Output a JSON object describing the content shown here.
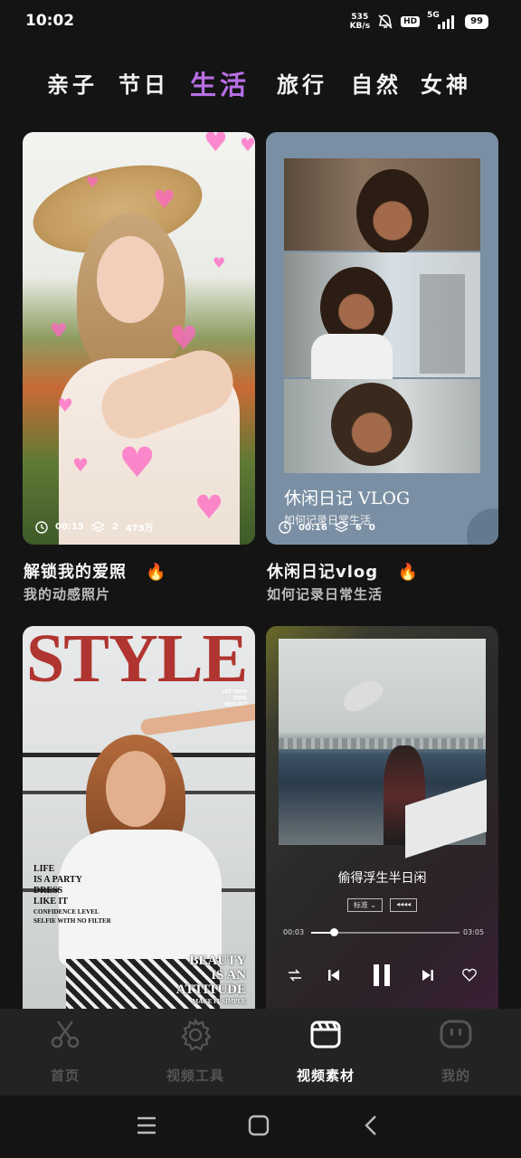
{
  "status_bar": {
    "time": "10:02",
    "net_speed_value": "535",
    "net_speed_unit": "KB/s",
    "hd": "HD",
    "network": "5G",
    "battery": "99"
  },
  "categories": [
    {
      "label": "亲子",
      "active": false
    },
    {
      "label": "节日",
      "active": false
    },
    {
      "label": "生活",
      "active": true
    },
    {
      "label": "旅行",
      "active": false
    },
    {
      "label": "自然",
      "active": false
    },
    {
      "label": "女神",
      "active": false
    }
  ],
  "cards": [
    {
      "title": "解锁我的爱照",
      "subtitle": "我的动感照片",
      "duration": "00:15",
      "layers": "2",
      "views": "473万",
      "hot_icon": "fire-icon"
    },
    {
      "title": "休闲日记vlog",
      "subtitle": "如何记录日常生活",
      "duration": "00:16",
      "layers": "6",
      "views": "0",
      "overlay_title": "休闲日记 VLOG",
      "overlay_subtitle": "如何记录日常生活",
      "hot_icon": "fire-icon"
    },
    {
      "magazine_title": "STYLE",
      "side_text": "LET YOUR SOUL REFLECT WHO YOU TRULY ARE",
      "left_text_1": "LIFE",
      "left_text_2": "IS A PARTY",
      "left_text_3": "DRESS",
      "left_text_4": "LIKE IT",
      "left_text_5": "CONFIDENCE LEVEL",
      "left_text_6": "SELFIE WITH NO FILTER",
      "beauty_1": "BEAUTY",
      "beauty_2": "IS AN",
      "beauty_3": "ATTITUDE",
      "beauty_4": "MAKE IT SIMPLE"
    },
    {
      "song_title": "偷得浮生半日闲",
      "quality": "标准",
      "effect_label": "◂◂◂◂",
      "time_current": "00:03",
      "time_total": "03:05",
      "progress": 0.15
    }
  ],
  "bottom_nav": [
    {
      "label": "首页",
      "icon": "scissors-icon",
      "active": false
    },
    {
      "label": "视频工具",
      "icon": "gear-icon",
      "active": false
    },
    {
      "label": "视频素材",
      "icon": "clapperboard-icon",
      "active": true
    },
    {
      "label": "我的",
      "icon": "face-icon",
      "active": false
    }
  ],
  "colors": {
    "background": "#141414",
    "accent": "#b86fe6",
    "nav_bar": "#232323",
    "inactive": "#555555"
  }
}
